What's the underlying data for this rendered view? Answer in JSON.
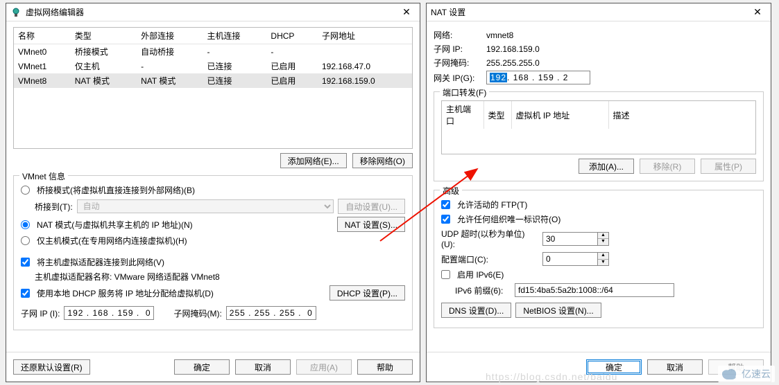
{
  "left": {
    "title": "虚拟网络编辑器",
    "columns": {
      "name": "名称",
      "type": "类型",
      "ext": "外部连接",
      "host": "主机连接",
      "dhcp": "DHCP",
      "subnet": "子网地址"
    },
    "rows": [
      {
        "name": "VMnet0",
        "type": "桥接模式",
        "ext": "自动桥接",
        "host": "-",
        "dhcp": "-",
        "subnet": ""
      },
      {
        "name": "VMnet1",
        "type": "仅主机",
        "ext": "-",
        "host": "已连接",
        "dhcp": "已启用",
        "subnet": "192.168.47.0"
      },
      {
        "name": "VMnet8",
        "type": "NAT 模式",
        "ext": "NAT 模式",
        "host": "已连接",
        "dhcp": "已启用",
        "subnet": "192.168.159.0"
      }
    ],
    "add_network": "添加网络(E)...",
    "remove_network": "移除网络(O)",
    "vmnet_info": "VMnet 信息",
    "bridge_radio": "桥接模式(将虚拟机直接连接到外部网络)(B)",
    "bridge_to": "桥接到(T):",
    "bridge_auto": "自动",
    "auto_settings": "自动设置(U)...",
    "nat_radio": "NAT 模式(与虚拟机共享主机的 IP 地址)(N)",
    "nat_settings": "NAT 设置(S)...",
    "hostonly_radio": "仅主机模式(在专用网络内连接虚拟机)(H)",
    "host_adapter_check": "将主机虚拟适配器连接到此网络(V)",
    "host_adapter_name": "主机虚拟适配器名称: VMware 网络适配器 VMnet8",
    "dhcp_check": "使用本地 DHCP 服务将 IP 地址分配给虚拟机(D)",
    "dhcp_settings": "DHCP 设置(P)...",
    "subnet_ip_label": "子网 IP (I):",
    "subnet_ip": "192 . 168 . 159 .  0",
    "subnet_mask_label": "子网掩码(M):",
    "subnet_mask": "255 . 255 . 255 .  0",
    "restore": "还原默认设置(R)",
    "ok": "确定",
    "cancel": "取消",
    "apply": "应用(A)",
    "help": "帮助"
  },
  "right": {
    "title": "NAT 设置",
    "network_label": "网络:",
    "network_value": "vmnet8",
    "subnet_ip_label": "子网 IP:",
    "subnet_ip": "192.168.159.0",
    "subnet_mask_label": "子网掩码:",
    "subnet_mask": "255.255.255.0",
    "gateway_label": "网关 IP(G):",
    "gateway_sel": "192",
    "gateway_rest": " . 168 . 159 .   2",
    "port_forward": "端口转发(F)",
    "pf_cols": {
      "hostport": "主机端口",
      "type": "类型",
      "vmip": "虚拟机 IP 地址",
      "desc": "描述"
    },
    "pf_add": "添加(A)...",
    "pf_remove": "移除(R)",
    "pf_props": "属性(P)",
    "advanced": "高级",
    "allow_ftp": "允许活动的 FTP(T)",
    "allow_any_org": "允许任何组织唯一标识符(O)",
    "udp_timeout_label": "UDP 超时(以秒为单位)(U):",
    "udp_timeout": "30",
    "config_port_label": "配置端口(C):",
    "config_port": "0",
    "enable_ipv6": "启用 IPv6(E)",
    "ipv6_prefix_label": "IPv6 前缀(6):",
    "ipv6_prefix": "fd15:4ba5:5a2b:1008::/64",
    "dns_settings": "DNS 设置(D)...",
    "netbios_settings": "NetBIOS 设置(N)...",
    "ok": "确定",
    "cancel": "取消",
    "help": "帮助"
  },
  "watermark": "亿速云",
  "bgtext": "https://blog.csdn.net/baidu"
}
